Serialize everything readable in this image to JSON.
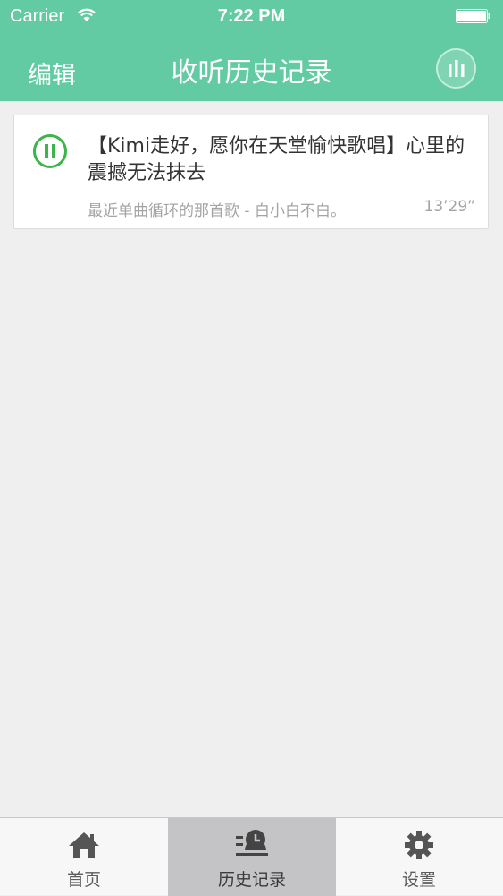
{
  "status_bar": {
    "carrier": "Carrier",
    "time": "7:22 PM"
  },
  "nav": {
    "edit_label": "编辑",
    "title": "收听历史记录"
  },
  "history": [
    {
      "title": "【Kimi走好，愿你在天堂愉快歌唱】心里的震撼无法抹去",
      "album": "最近单曲循环的那首歌 - 白小白不白。",
      "duration": "13’29”",
      "state": "playing"
    }
  ],
  "tabs": [
    {
      "label": "首页",
      "icon": "home-icon",
      "active": false
    },
    {
      "label": "历史记录",
      "icon": "history-icon",
      "active": true
    },
    {
      "label": "设置",
      "icon": "gear-icon",
      "active": false
    }
  ],
  "colors": {
    "accent": "#63cba4",
    "play_green": "#3ab54a",
    "background": "#efeff0"
  }
}
